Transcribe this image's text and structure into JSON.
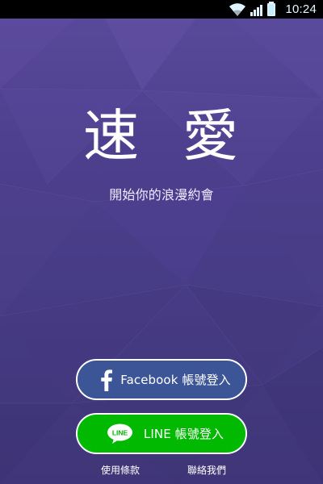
{
  "status_bar": {
    "time": "10:24",
    "icons": [
      "wifi-icon",
      "cellular-signal-icon",
      "battery-icon"
    ]
  },
  "app": {
    "title": "速 愛",
    "tagline": "開始你的浪漫約會"
  },
  "login": {
    "facebook_label": "Facebook 帳號登入",
    "line_label": "LINE 帳號登入",
    "line_icon_text": "LINE"
  },
  "footer": {
    "terms_label": "使用條款",
    "contact_label": "聯絡我們"
  },
  "colors": {
    "background_primary": "#4d3f8d",
    "facebook_blue": "#3b5596",
    "line_green": "#00b900",
    "white": "#ffffff"
  }
}
